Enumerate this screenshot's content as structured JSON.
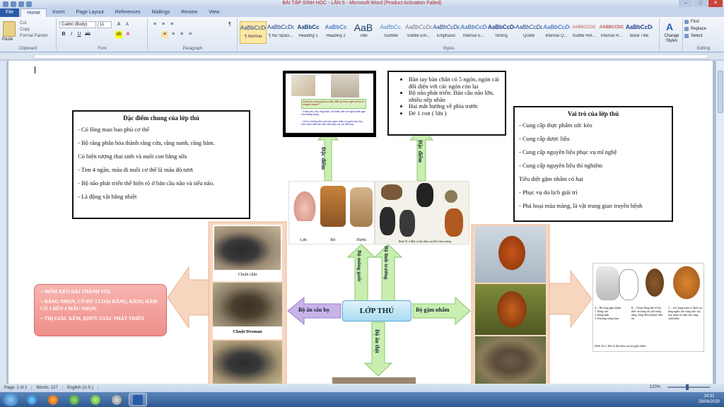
{
  "window": {
    "title": "BÀI TẬP SINH HỌC - LẦN 5 - Microsoft Word (Product Activation Failed)"
  },
  "tabs": [
    "File",
    "Home",
    "Insert",
    "Page Layout",
    "References",
    "Mailings",
    "Review",
    "View"
  ],
  "ribbon": {
    "clipboard": {
      "paste": "Paste",
      "cut": "Cut",
      "copy": "Copy",
      "format_painter": "Format Painter",
      "label": "Clipboard"
    },
    "font": {
      "name": "Calibri (Body)",
      "size": "11",
      "label": "Font"
    },
    "paragraph": {
      "label": "Paragraph"
    },
    "styles": {
      "label": "Styles",
      "items": [
        {
          "sample": "AaBbCcDc",
          "name": "¶ Normal"
        },
        {
          "sample": "AaBbCcDc",
          "name": "¶ No Spaci..."
        },
        {
          "sample": "AaBbCc",
          "name": "Heading 1"
        },
        {
          "sample": "AaBbCc",
          "name": "Heading 2"
        },
        {
          "sample": "AaB",
          "name": "Title"
        },
        {
          "sample": "AaBbCc.",
          "name": "Subtitle"
        },
        {
          "sample": "AaBbCcDc",
          "name": "Subtle Em..."
        },
        {
          "sample": "AaBbCcDc",
          "name": "Emphasis"
        },
        {
          "sample": "AaBbCcDc",
          "name": "Intense E..."
        },
        {
          "sample": "AaBbCcDc",
          "name": "Strong"
        },
        {
          "sample": "AaBbCcDc",
          "name": "Quote"
        },
        {
          "sample": "AaBbCcDc",
          "name": "Intense Q..."
        },
        {
          "sample": "AABBCCDC",
          "name": "Subtle Ref..."
        },
        {
          "sample": "AABBCCDC",
          "name": "Intense R..."
        },
        {
          "sample": "AaBbCcDc",
          "name": "Book Title"
        }
      ],
      "change_styles": "Change Styles"
    },
    "editing": {
      "label": "Editing",
      "find": "Find",
      "replace": "Replace",
      "select": "Select"
    }
  },
  "document": {
    "left_box": {
      "title": "Đặc điểm chung của lớp thú",
      "lines": [
        "- Có lông mao bao phủ cơ thể",
        "- Bộ răng phân hóa thành răng cửa, răng nanh, răng hàm.",
        "  Có hiện tượng thai sinh và nuôi con bằng sữa",
        "- Tim 4 ngăn, máu đi nuôi cơ thể là máu đỏ tươi",
        "- Bộ não phát triển thể hiện rõ ở bán cầu não và tiểu não.",
        "- Là động vật hằng nhiệt"
      ]
    },
    "right_box": {
      "title": "Vai trò của lớp thú",
      "lines": [
        "- Cung cấp thực phẩm sức kéo",
        "- Cung cấp dược liệu",
        "- Cung cấp nguyên liệu phục vụ mĩ nghệ",
        "- Cung cấp nguyên liệu thí nghiệm",
        "  Tiêu diệt gặm nhấm có hại",
        "- Phục vụ du lịch giải trí",
        "- Phá hoại mùa màng, là vật trung gian truyền bệnh"
      ]
    },
    "top_right_box": {
      "items": [
        "Bàn tay bàn chân có 5 ngón, ngón cái đối diện với các ngón còn lại",
        "Bộ não phát triển: Bán cầu não lớn, nhiều nếp nhăn",
        "Hai mắt hướng về phía trước",
        "Đẻ 1 con ( lứa )"
      ]
    },
    "screenshot_text": {
      "question": "Chân thú móng guốc có đặc điểm gì thích nghi với lối di chuyển nhanh?",
      "answer1": "- Chân cao, trục ống chân, cổ chân, bàn và ngón chân gần như thẳng hàng",
      "answer2": "- Chỉ có những đốt cuối của ngón chân có guốc bao bọc mới chạm đất nên diện tích tiếp xúc với đất hẹp."
    },
    "pink_box": {
      "lines": [
        "+ MÕM KÉO DÀI THÀNH VÒI .",
        "+ RĂNG NHỌN, CÓ ĐỦ 3 LOẠI RĂNG, RĂNG HÀM CÓ 3 ĐẾN 4 MẤU NHỌN.",
        "+ THỊ GIÁC KÉM, KHỨU GIÁC PHÁT TRIỂN"
      ]
    },
    "center_node": "LỚP THÚ",
    "arrows": {
      "up_left": "Đặc điểm",
      "up_right": "Đặc điểm",
      "left": "Bộ ăn sâu bọ",
      "right": "Bộ gặm nhấm",
      "down": "Bộ ăn thịt",
      "up_mid_left": "Bộ móng guốc",
      "up_mid_right": "Bộ linh trưởng"
    },
    "captions": {
      "mole1": "Chuột chũi",
      "mole2": "Chuột Desman",
      "hoofed": [
        "Lợn",
        "Bò",
        "Hươu"
      ],
      "primate": "Hình 51.4 Một số đại diện của Bộ Linh trưởng",
      "rodent_panel": "A – Bộ răng gặm nhấm\n1. Răng cửa\n2. Răng hàm\n3. Khoảng trống hàm",
      "rodent_panel_b": "B – Chuột đồng đào lỗ lấy thức ăn hang chỉ yêu hàng răng, bằng điều khuyết thức ăn.",
      "rodent_panel_c": "C – Sóc bụng xám có đuôi xù, lông ngắn, tìm sống trên cây, hay nhảy từ cành này sang cành khác.",
      "rodent_fig": "Hình 50.2. Một số đại diện của bộ gặm nhấm"
    }
  },
  "status": {
    "page": "Page: 1 of 2",
    "words": "Words: 227",
    "lang": "English (U.S.)",
    "zoom": "120%"
  },
  "tray": {
    "time": "14:31",
    "date": "29/04/2020"
  },
  "colors": {
    "word_blue": "#2a5ba8",
    "green_arrow": "#c9efb0",
    "peach_arrow": "#f7d6bf",
    "purple_arrow": "#c8b3e8",
    "pink_box": "#f09c98",
    "center_node": "#a7dcf2"
  }
}
